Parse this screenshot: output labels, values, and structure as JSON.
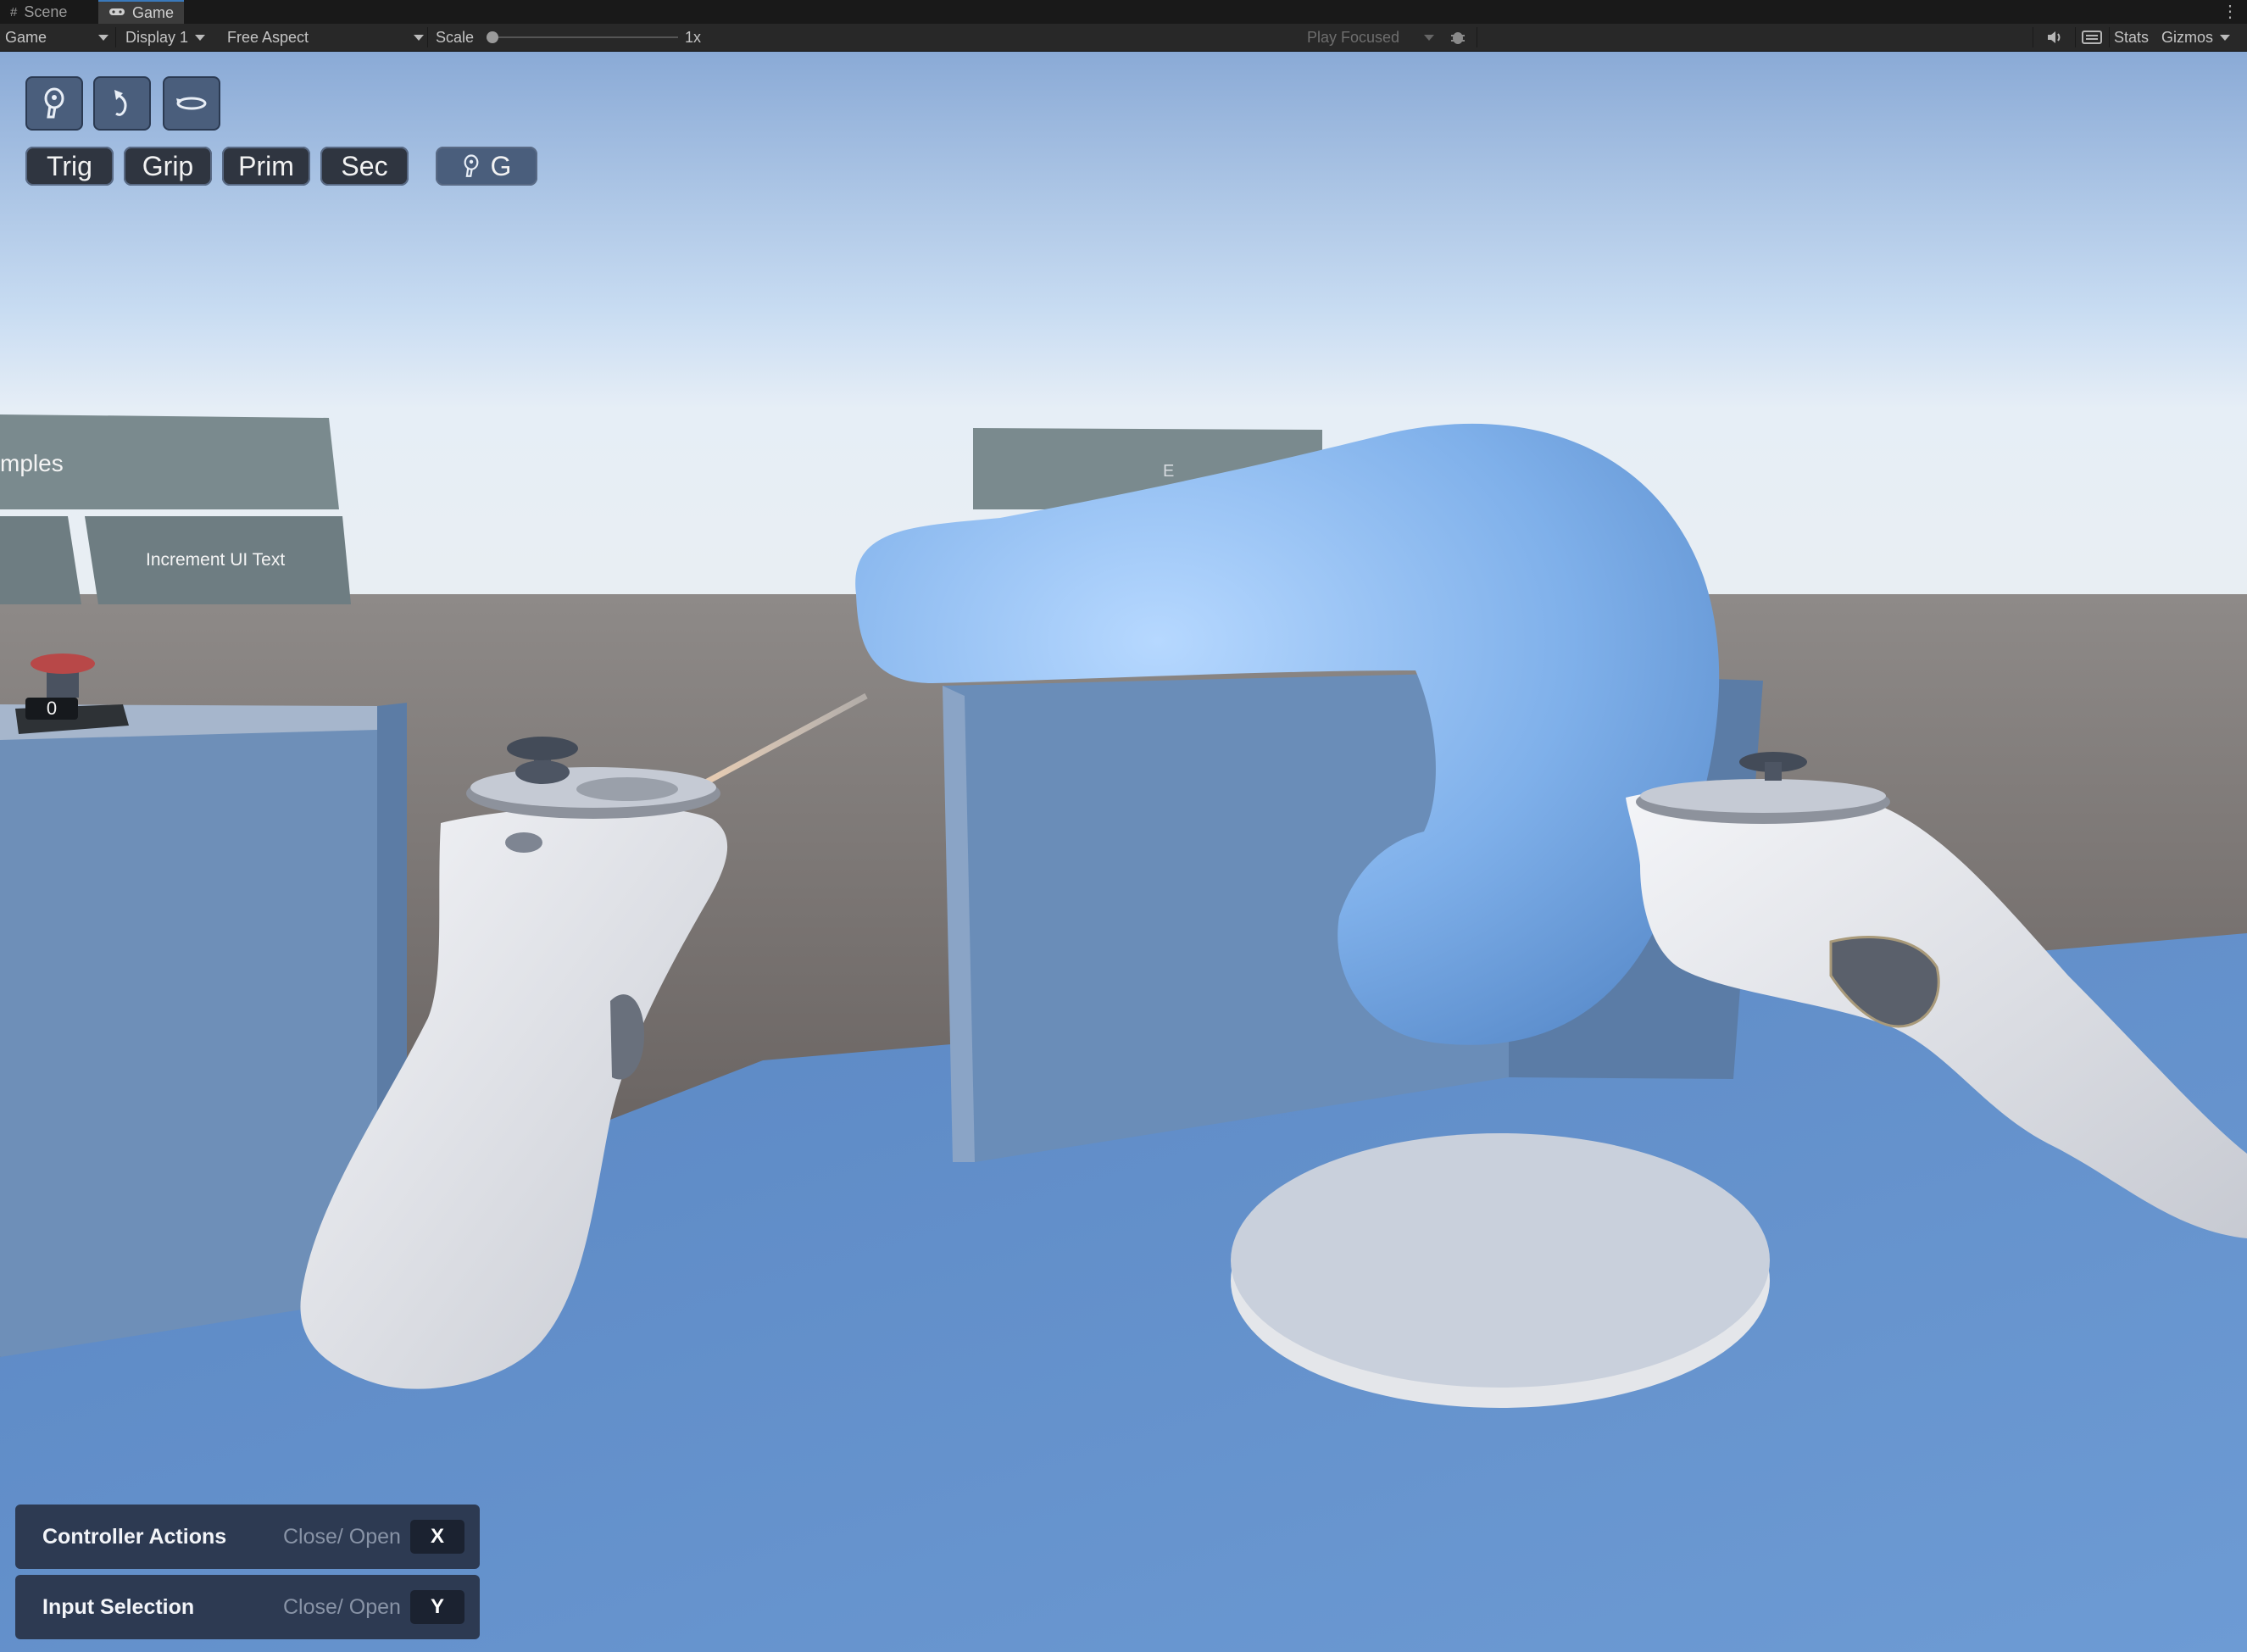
{
  "tabs": [
    {
      "label": "Scene",
      "icon": "grid-icon"
    },
    {
      "label": "Game",
      "icon": "gamepad-icon"
    }
  ],
  "toolbar": {
    "view_mode": "Game",
    "display": "Display 1",
    "aspect": "Free Aspect",
    "scale_label": "Scale",
    "scale_value": "1x",
    "play_mode": "Play Focused",
    "stats": "Stats",
    "gizmos": "Gizmos"
  },
  "hud": {
    "icon_buttons": [
      {
        "icon": "controller-icon"
      },
      {
        "icon": "rotate-icon"
      },
      {
        "icon": "orbit-icon"
      }
    ],
    "input_buttons": [
      "Trig",
      "Grip",
      "Prim",
      "Sec"
    ],
    "mode_button": {
      "icon": "controller-icon",
      "label": "G"
    }
  },
  "scene": {
    "sign_left": "mples",
    "sign_button": "Increment UI Text",
    "counter": "0",
    "sign_right_fragment": "E"
  },
  "panels": [
    {
      "title": "Controller Actions",
      "action": "Close/ Open",
      "key": "X"
    },
    {
      "title": "Input Selection",
      "action": "Close/ Open",
      "key": "Y"
    }
  ]
}
